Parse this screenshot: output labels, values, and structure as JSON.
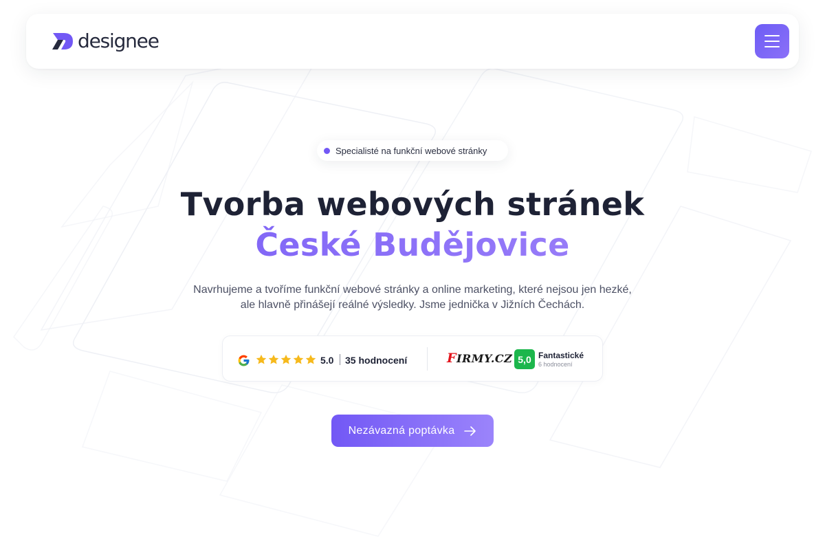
{
  "brand": {
    "name": "designee",
    "accent": "#7258f5",
    "accent_light": "#a78bfa"
  },
  "nav": {
    "menu_icon": "hamburger-icon"
  },
  "hero": {
    "eyebrow": "Specialisté na funkční webové stránky",
    "title_line1": "Tvorba webových stránek",
    "title_line2": "České Budějovice",
    "subtitle": "Navrhujeme a tvoříme funkční webové stránky a online marketing, které nejsou jen hezké, ale hlavně přinášejí reálné výsledky. Jsme jednička v Jižních Čechách."
  },
  "ratings": {
    "google": {
      "icon": "google-icon",
      "stars": 5,
      "score": "5.0",
      "count": "35 hodnocení"
    },
    "firmy": {
      "logo_prefix": "F",
      "logo_rest": "IRMY.CZ",
      "score": "5,0",
      "label": "Fantastické",
      "count": "6 hodnocení",
      "badge_color": "#1cb64c"
    }
  },
  "cta": {
    "label": "Nezávazná poptávka",
    "icon": "arrow-right-icon"
  }
}
